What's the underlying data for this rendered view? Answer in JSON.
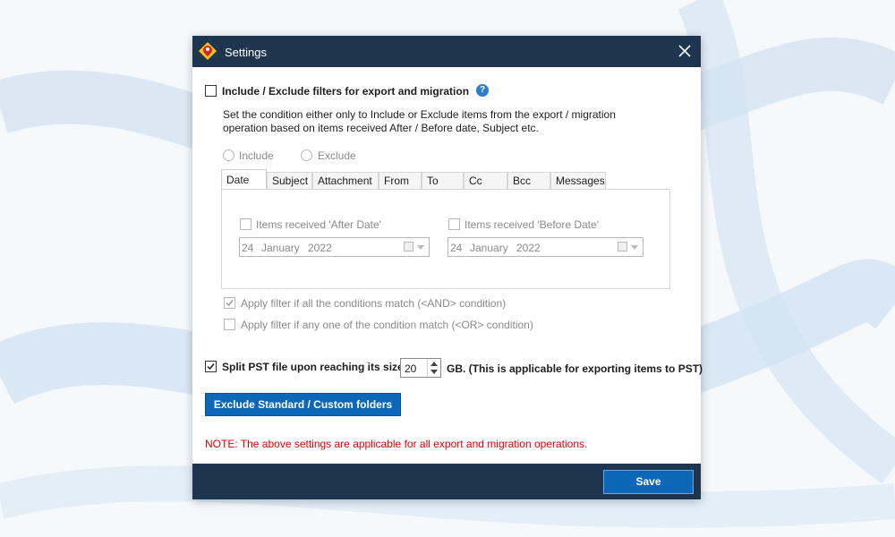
{
  "window": {
    "title": "Settings",
    "icon": "app-logo-icon",
    "close_icon": "close-icon"
  },
  "filters": {
    "enable_label": "Include / Exclude filters for export and migration",
    "enabled": false,
    "help_icon": "question-mark-icon",
    "help_glyph": "?",
    "description_line1": "Set the condition either only to Include or Exclude items from the export / migration",
    "description_line2": "operation based on items received After / Before date, Subject etc.",
    "mode_options": [
      "Include",
      "Exclude"
    ],
    "tabs": [
      "Date",
      "Subject",
      "Attachment",
      "From",
      "To",
      "Cc",
      "Bcc",
      "Messages"
    ],
    "active_tab": "Date",
    "after_date": {
      "label": "Items received 'After Date'",
      "checked": false,
      "day": "24",
      "month": "January",
      "year": "2022"
    },
    "before_date": {
      "label": "Items received 'Before Date'",
      "checked": false,
      "day": "24",
      "month": "January",
      "year": "2022"
    },
    "and_label": "Apply filter if all the conditions match (<AND> condition)",
    "and_checked": true,
    "or_label": "Apply filter if any one of the condition match (<OR> condition)",
    "or_checked": false
  },
  "split": {
    "label": "Split PST file upon reaching its size",
    "checked": true,
    "size": "20",
    "suffix": "GB. (This is applicable for exporting items to PST)"
  },
  "exclude_button": "Exclude Standard / Custom folders",
  "note": "NOTE: The above settings are applicable for all export and migration operations.",
  "save_button": "Save",
  "colors": {
    "titlebar": "#1e3550",
    "button": "#0d67b9",
    "note": "#e00000",
    "help": "#2f7ec7"
  }
}
